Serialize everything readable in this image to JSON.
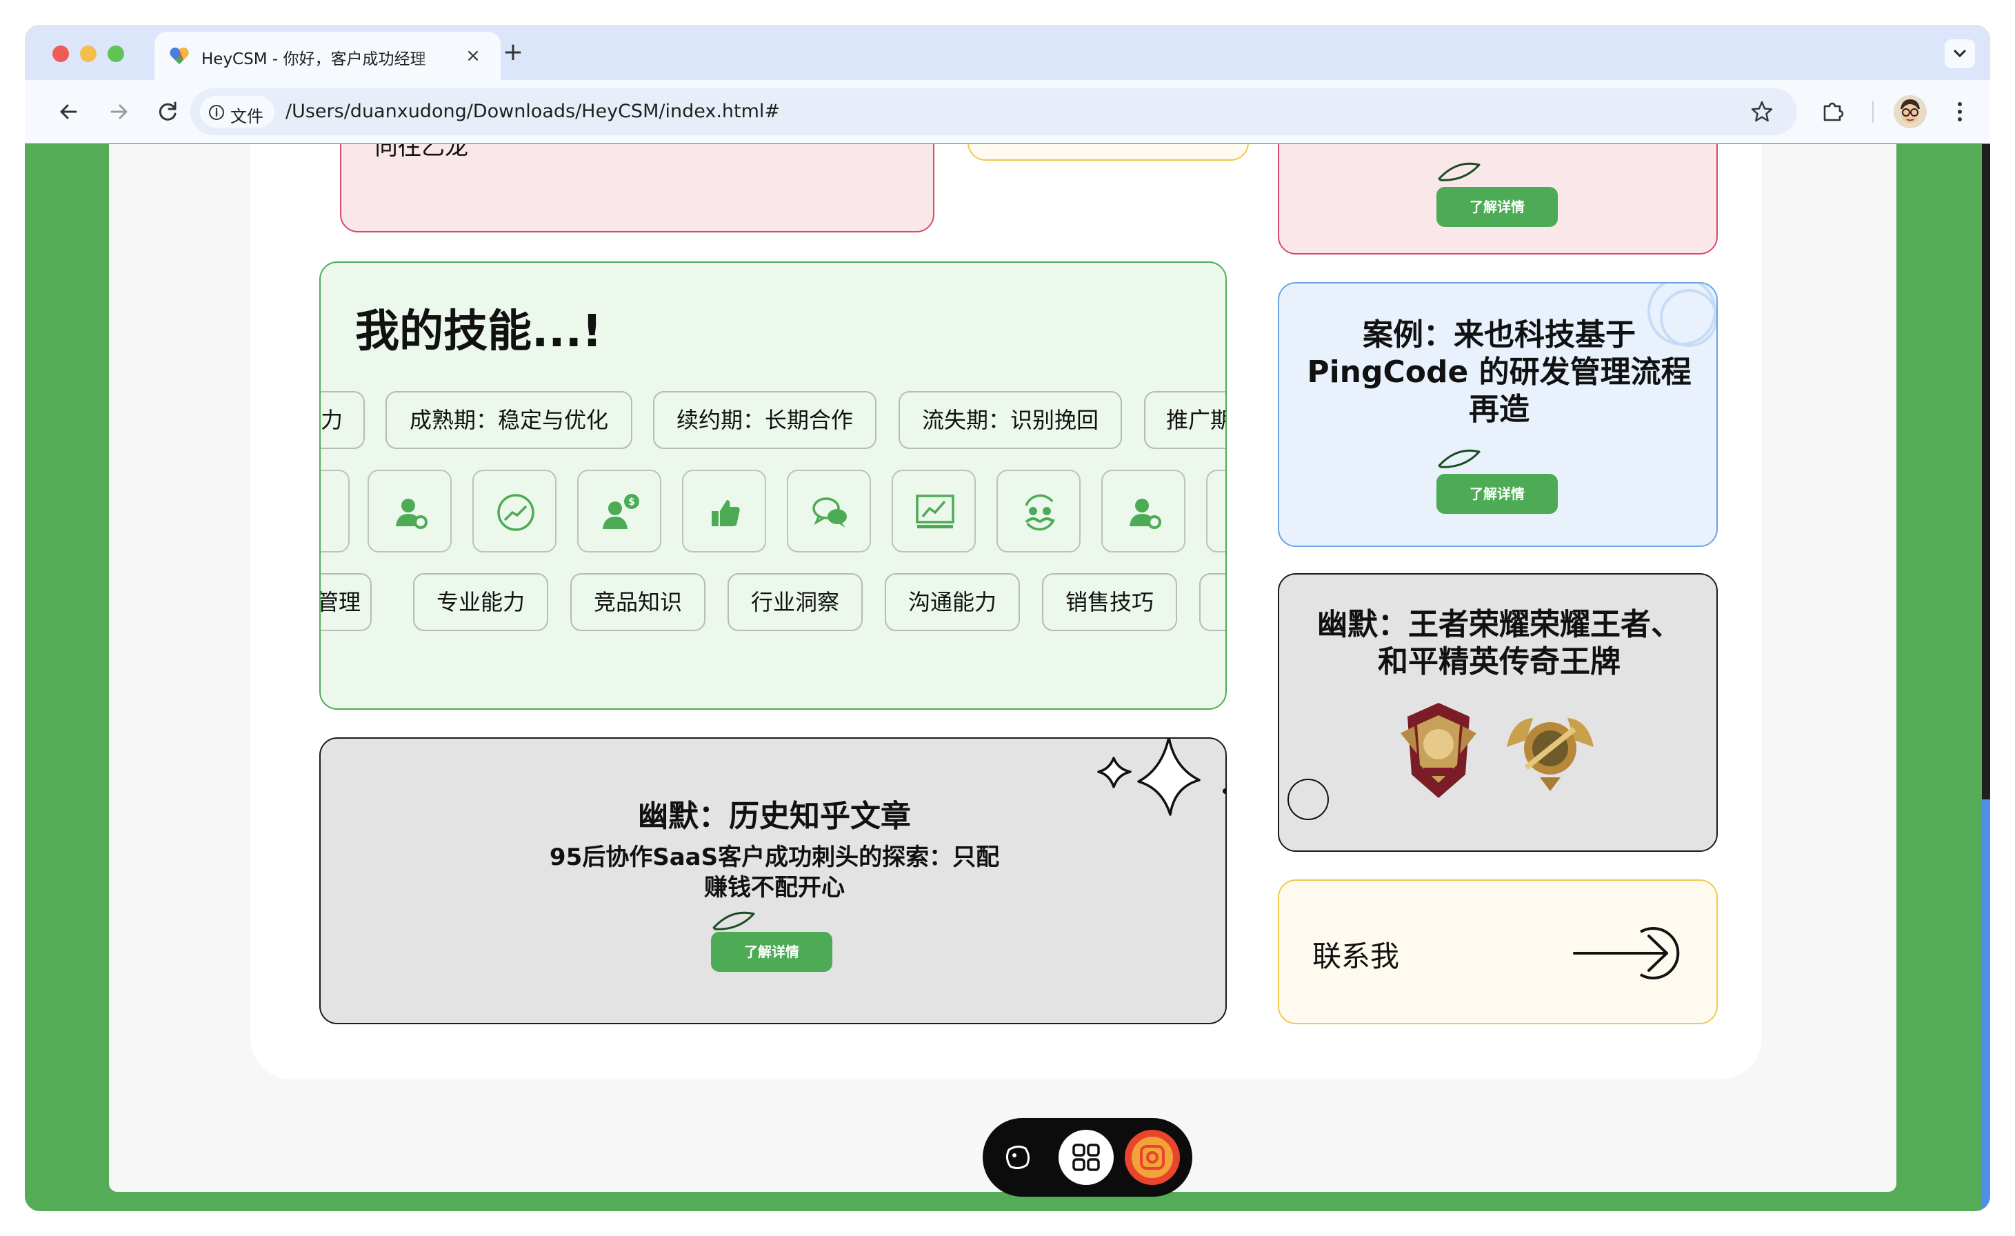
{
  "browser": {
    "tab_title": "HeyCSM - 你好，客户成功经理",
    "tab_close": "×",
    "new_tab": "+",
    "site_info_label": "文件",
    "url": "/Users/duanxudong/Downloads/HeyCSM/index.html#"
  },
  "page": {
    "top_left_card_text": "向往乙龙",
    "top_right_card_button": "了解详情",
    "case_card": {
      "title": "案例：来也科技基于 PingCode 的研发管理流程再造",
      "button": "了解详情"
    },
    "skills": {
      "title": "我的技能...!",
      "row1": [
        "力",
        "成熟期：稳定与优化",
        "续约期：长期合作",
        "流失期：识别挽回",
        "推广期"
      ],
      "icons": [
        "user-gear-icon",
        "chart-circle-icon",
        "user-dollar-icon",
        "thumbs-up-icon",
        "chat-bubbles-icon",
        "presentation-chart-icon",
        "user-sync-icon",
        "user-gear-icon"
      ],
      "row3": [
        "管理",
        "专业能力",
        "竞品知识",
        "行业洞察",
        "沟通能力",
        "销售技巧"
      ]
    },
    "humor_games": {
      "title": "幽默：王者荣耀荣耀王者、和平精英传奇王牌"
    },
    "humor_articles": {
      "title": "幽默：历史知乎文章",
      "subtitle": "95后协作SaaS客户成功刺头的探索：只配赚钱不配开心",
      "button": "了解详情"
    },
    "contact": {
      "label": "联系我"
    }
  },
  "colors": {
    "brand_green": "#54ad56",
    "button_green": "#4dab55",
    "pink_card": "#f9e7ea",
    "pink_border": "#d84a6b",
    "blue_card": "#e8f1fc",
    "blue_border": "#6aa4e6",
    "green_card": "#ecf8eb",
    "gray_card": "#e3e3e3",
    "cream_card": "#fefaef",
    "cream_border": "#f1c94d"
  }
}
